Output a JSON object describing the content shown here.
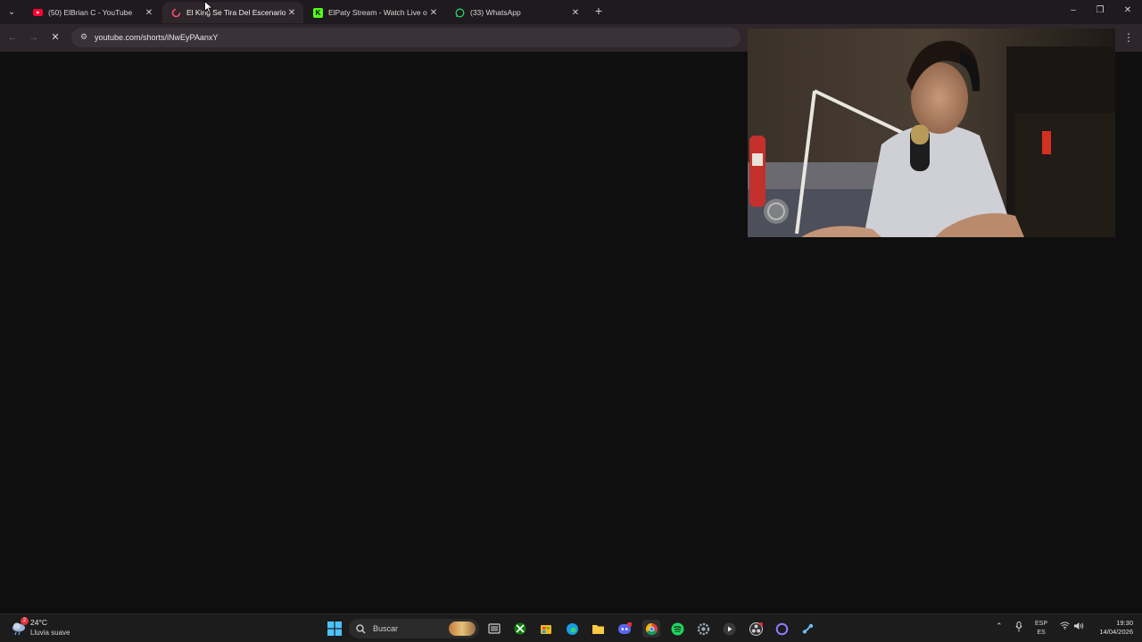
{
  "browser": {
    "tabs": [
      {
        "title": "(50) ElBrian C - YouTube",
        "favicon": "youtube-icon",
        "color": "#ff0033"
      },
      {
        "title": "El King Se Tira Del Escenario 😳",
        "favicon": "youtube-shorts-loading-icon",
        "color": "#ff4f6d"
      },
      {
        "title": "ElPaty Stream - Watch Live on K",
        "favicon": "kick-icon",
        "color": "#53fc18"
      },
      {
        "title": "(33) WhatsApp",
        "favicon": "whatsapp-icon",
        "color": "#25d366"
      }
    ],
    "url": "youtube.com/shorts/iNwEyPAanxY"
  },
  "taskbar": {
    "weather": {
      "temp": "24°C",
      "desc": "Lluvia suave",
      "badge": "2"
    },
    "search_placeholder": "Buscar",
    "lang_top": "ESP",
    "lang_bottom": "ES",
    "time": "19:30",
    "date": "14/04/2026",
    "apps": [
      "windows-start-icon",
      "task-view-icon",
      "xbox-icon",
      "microsoft-store-icon",
      "edge-icon",
      "file-explorer-icon",
      "discord-icon",
      "chrome-icon",
      "spotify-icon",
      "settings-icon",
      "media-player-icon",
      "obs-icon",
      "cortana-icon",
      "steam-icon"
    ]
  },
  "colors": {
    "tabstrip": "#1f1a1e",
    "toolbar": "#2e262b",
    "content": "#0f0f0f",
    "taskbar": "#1c1c1c"
  }
}
